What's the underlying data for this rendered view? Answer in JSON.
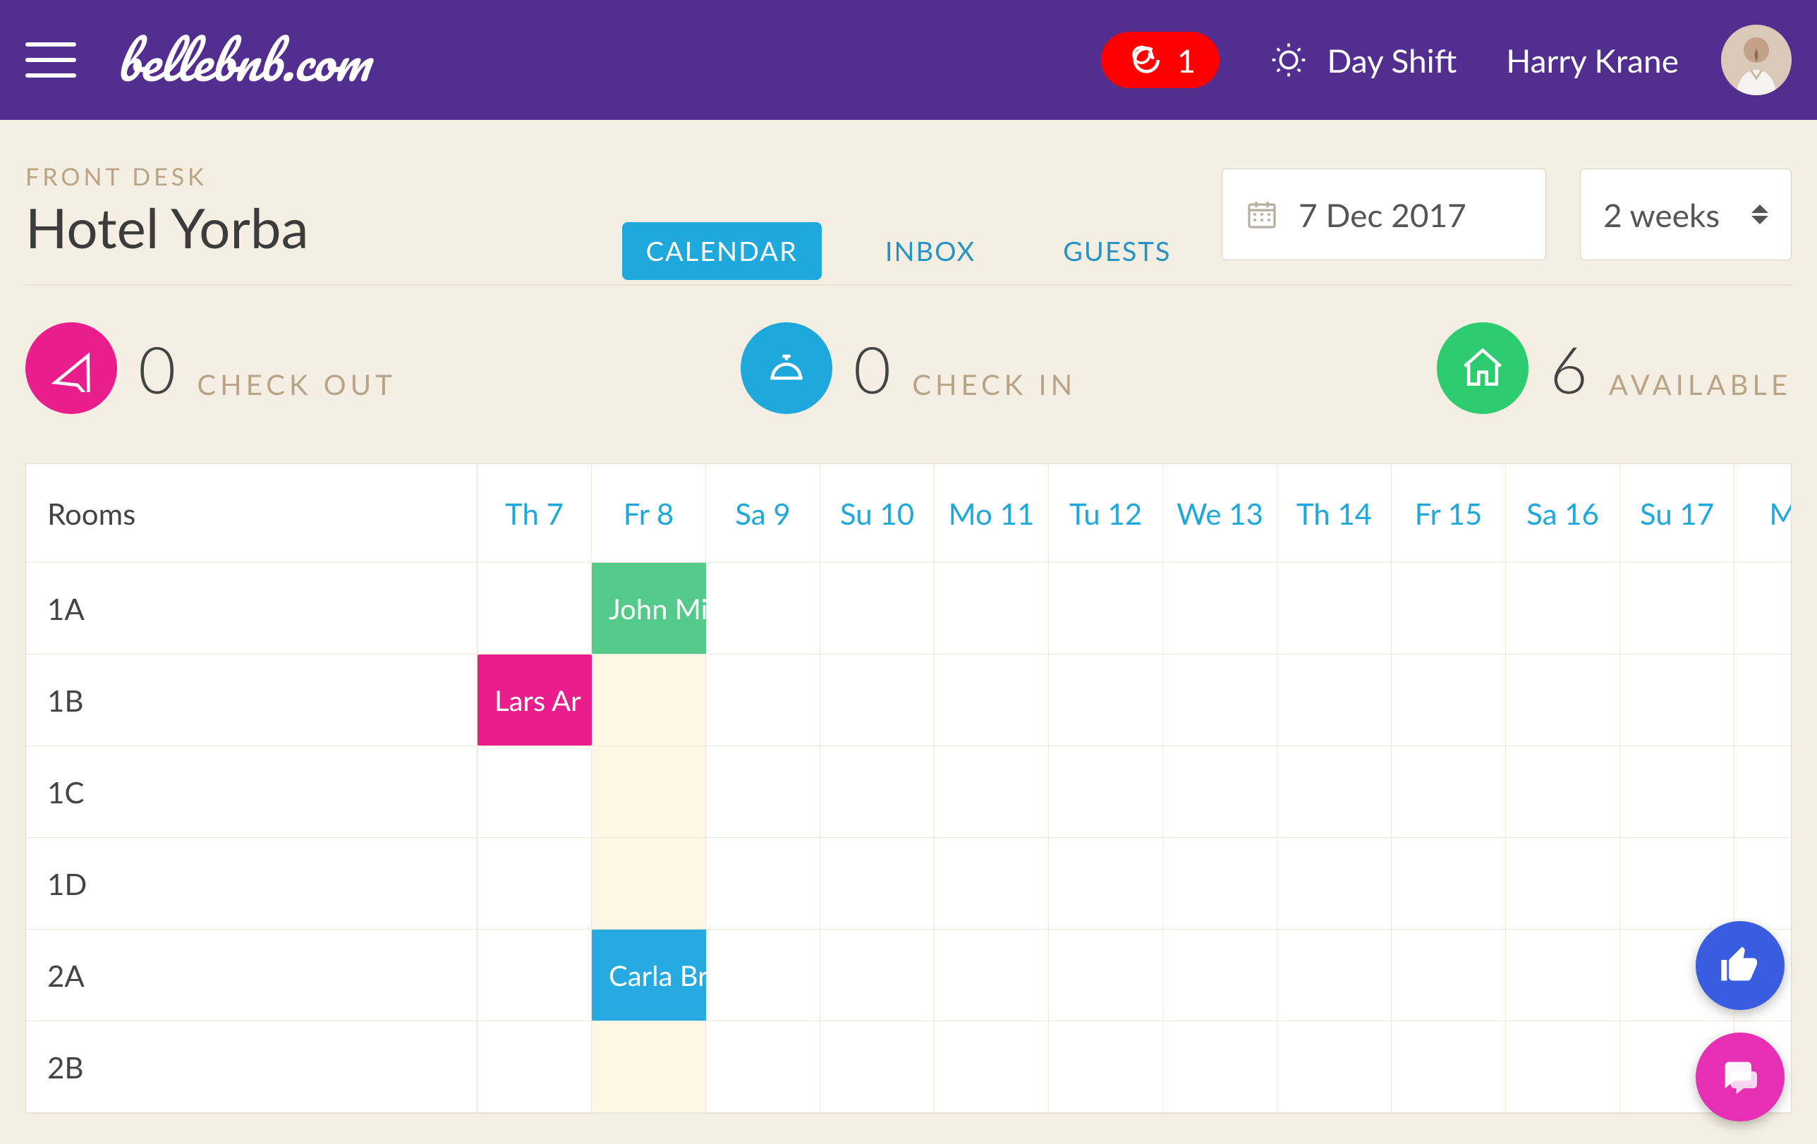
{
  "topbar": {
    "brand": "bellebnb.com",
    "chat_count": "1",
    "shift": "Day Shift",
    "user_name": "Harry Krane"
  },
  "page": {
    "breadcrumb": "FRONT DESK",
    "hotel_name": "Hotel Yorba",
    "date": "7 Dec 2017",
    "range": "2 weeks"
  },
  "tabs": [
    {
      "label": "CALENDAR",
      "active": true
    },
    {
      "label": "INBOX",
      "active": false
    },
    {
      "label": "GUESTS",
      "active": false
    }
  ],
  "stats": {
    "checkout": {
      "value": "0",
      "label": "CHECK OUT"
    },
    "checkin": {
      "value": "0",
      "label": "CHECK IN"
    },
    "available": {
      "value": "6",
      "label": "AVAILABLE"
    }
  },
  "calendar": {
    "rooms_label": "Rooms",
    "days": [
      {
        "label": "Th 7",
        "weekend": false
      },
      {
        "label": "Fr 8",
        "weekend": true
      },
      {
        "label": "Sa 9",
        "weekend": false
      },
      {
        "label": "Su 10",
        "weekend": false
      },
      {
        "label": "Mo 11",
        "weekend": false
      },
      {
        "label": "Tu 12",
        "weekend": false
      },
      {
        "label": "We 13",
        "weekend": false
      },
      {
        "label": "Th 14",
        "weekend": false
      },
      {
        "label": "Fr 15",
        "weekend": false
      },
      {
        "label": "Sa 16",
        "weekend": false
      },
      {
        "label": "Su 17",
        "weekend": false
      },
      {
        "label": "Mo",
        "weekend": false
      }
    ],
    "rooms": [
      "1A",
      "1B",
      "1C",
      "1D",
      "2A",
      "2B"
    ],
    "bookings": [
      {
        "room": "1A",
        "start": 1,
        "span": 3,
        "guest": "John Michael Kane",
        "color": "green"
      },
      {
        "room": "1B",
        "start": 0,
        "span": 1,
        "guest": "Lars Ar",
        "color": "pink"
      },
      {
        "room": "2A",
        "start": 1,
        "span": 5,
        "guest": "Carla Brunelli",
        "color": "blue"
      }
    ]
  }
}
